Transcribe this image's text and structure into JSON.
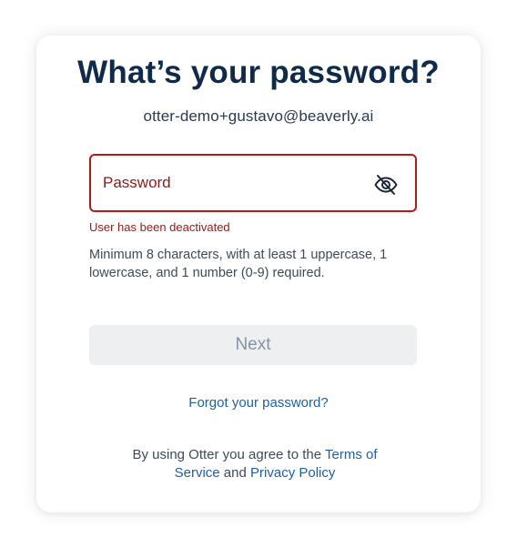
{
  "login": {
    "title": "What’s your password?",
    "email": "otter-demo+gustavo@beaverly.ai",
    "password_placeholder": "Password",
    "password_value": "",
    "error_message": "User has been deactivated",
    "hint": "Minimum 8 characters, with at least 1 uppercase, 1 lowercase, and 1 number (0-9) required.",
    "next_label": "Next",
    "forgot_label": "Forgot your password?",
    "legal_prefix": "By using Otter you agree to the ",
    "terms_label": "Terms of Service",
    "legal_and": " and ",
    "privacy_label": "Privacy Policy"
  },
  "icons": {
    "visibility_toggle": "eye-slash-icon"
  },
  "colors": {
    "title": "#0f2a4a",
    "error": "#b31b1b",
    "link": "#1f5fa6",
    "button_disabled_bg": "#eeeff1",
    "button_disabled_text": "#8793a3"
  }
}
